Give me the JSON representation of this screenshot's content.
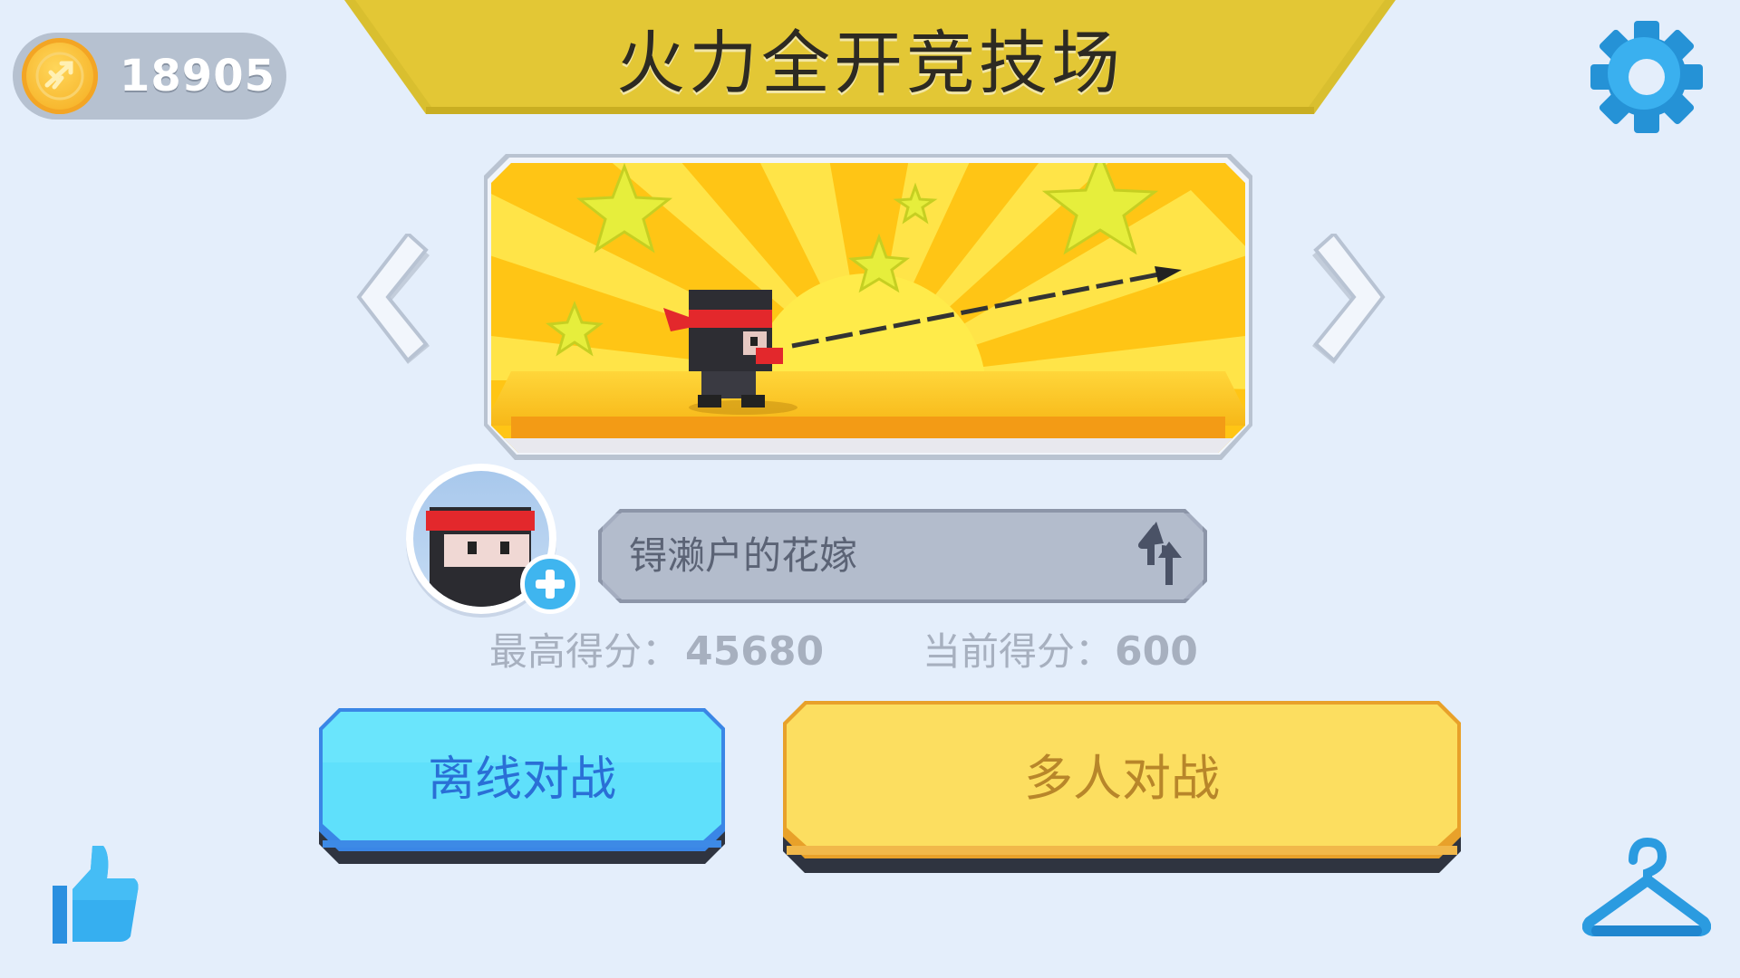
{
  "header": {
    "coins": "18905",
    "title": "火力全开竞技场"
  },
  "player": {
    "name": "锝濑户的花嫁"
  },
  "scores": {
    "best_label": "最高得分：",
    "best_value": "45680",
    "current_label": "当前得分：",
    "current_value": "600"
  },
  "buttons": {
    "offline": "离线对战",
    "multiplayer": "多人对战"
  },
  "icons": {
    "coin": "coin-icon",
    "settings": "gear-icon",
    "prev": "chevron-left-icon",
    "next": "chevron-right-icon",
    "add_avatar": "plus-icon",
    "shuffle_name": "shuffle-icon",
    "like": "thumbs-up-icon",
    "wardrobe": "hanger-icon"
  },
  "colors": {
    "background": "#e4eefb",
    "banner": "#e3c735",
    "accent_blue": "#2ea2e4",
    "offline_button": "#5fe0fb",
    "multiplayer_button": "#fcde60"
  }
}
